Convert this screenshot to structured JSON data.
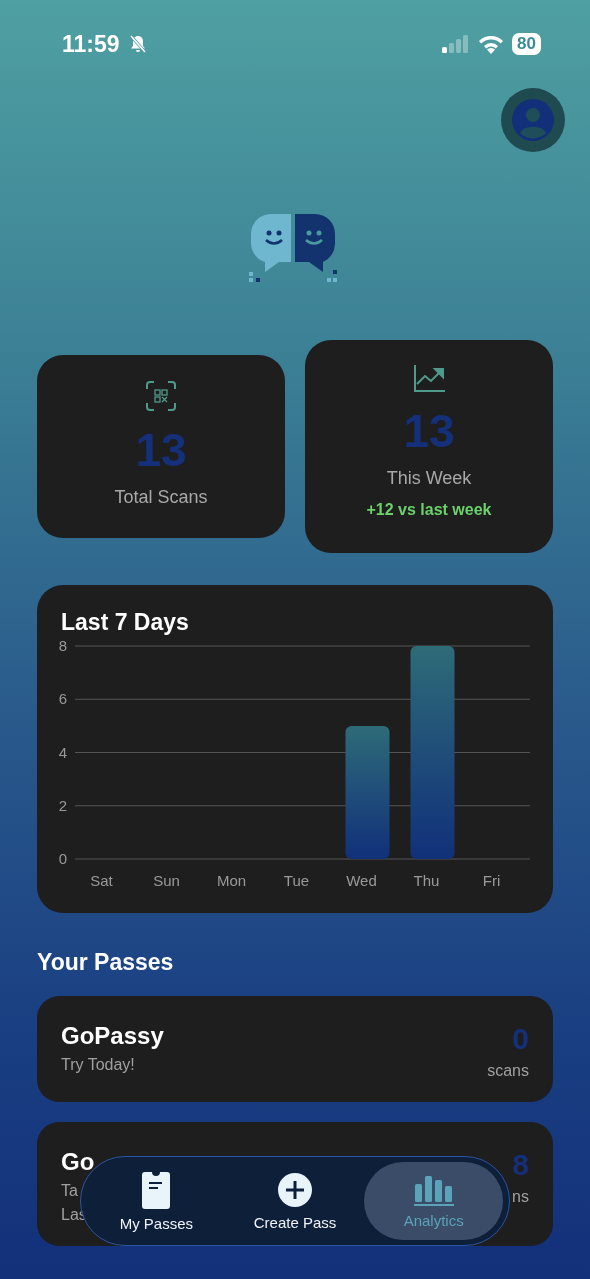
{
  "status_bar": {
    "time": "11:59",
    "battery": "80"
  },
  "stats": [
    {
      "kind": "scan",
      "value": "13",
      "label": "Total Scans"
    },
    {
      "kind": "trend",
      "value": "13",
      "label": "This Week",
      "change": "+12 vs last week"
    }
  ],
  "chart_card": {
    "title": "Last 7 Days",
    "chart_data": {
      "type": "bar",
      "categories": [
        "Sat",
        "Sun",
        "Mon",
        "Tue",
        "Wed",
        "Thu",
        "Fri"
      ],
      "values": [
        0,
        0,
        0,
        0,
        5,
        8,
        0
      ],
      "grid": true,
      "ylim": [
        0,
        8
      ],
      "yticks": [
        0,
        2,
        4,
        6,
        8
      ]
    }
  },
  "passes_heading": "Your Passes",
  "passes": [
    {
      "name": "GoPassy",
      "subtitle": "Try Today!",
      "count": "0",
      "unit": "scans"
    },
    {
      "name": "Go",
      "subtitle": "Ta",
      "last": "Las",
      "count": "8",
      "unit": "ns"
    }
  ],
  "tabs": [
    {
      "kind": "passes",
      "label": "My Passes",
      "selected": false
    },
    {
      "kind": "create",
      "label": "Create Pass",
      "selected": false
    },
    {
      "kind": "analytics",
      "label": "Analytics",
      "selected": true
    }
  ]
}
